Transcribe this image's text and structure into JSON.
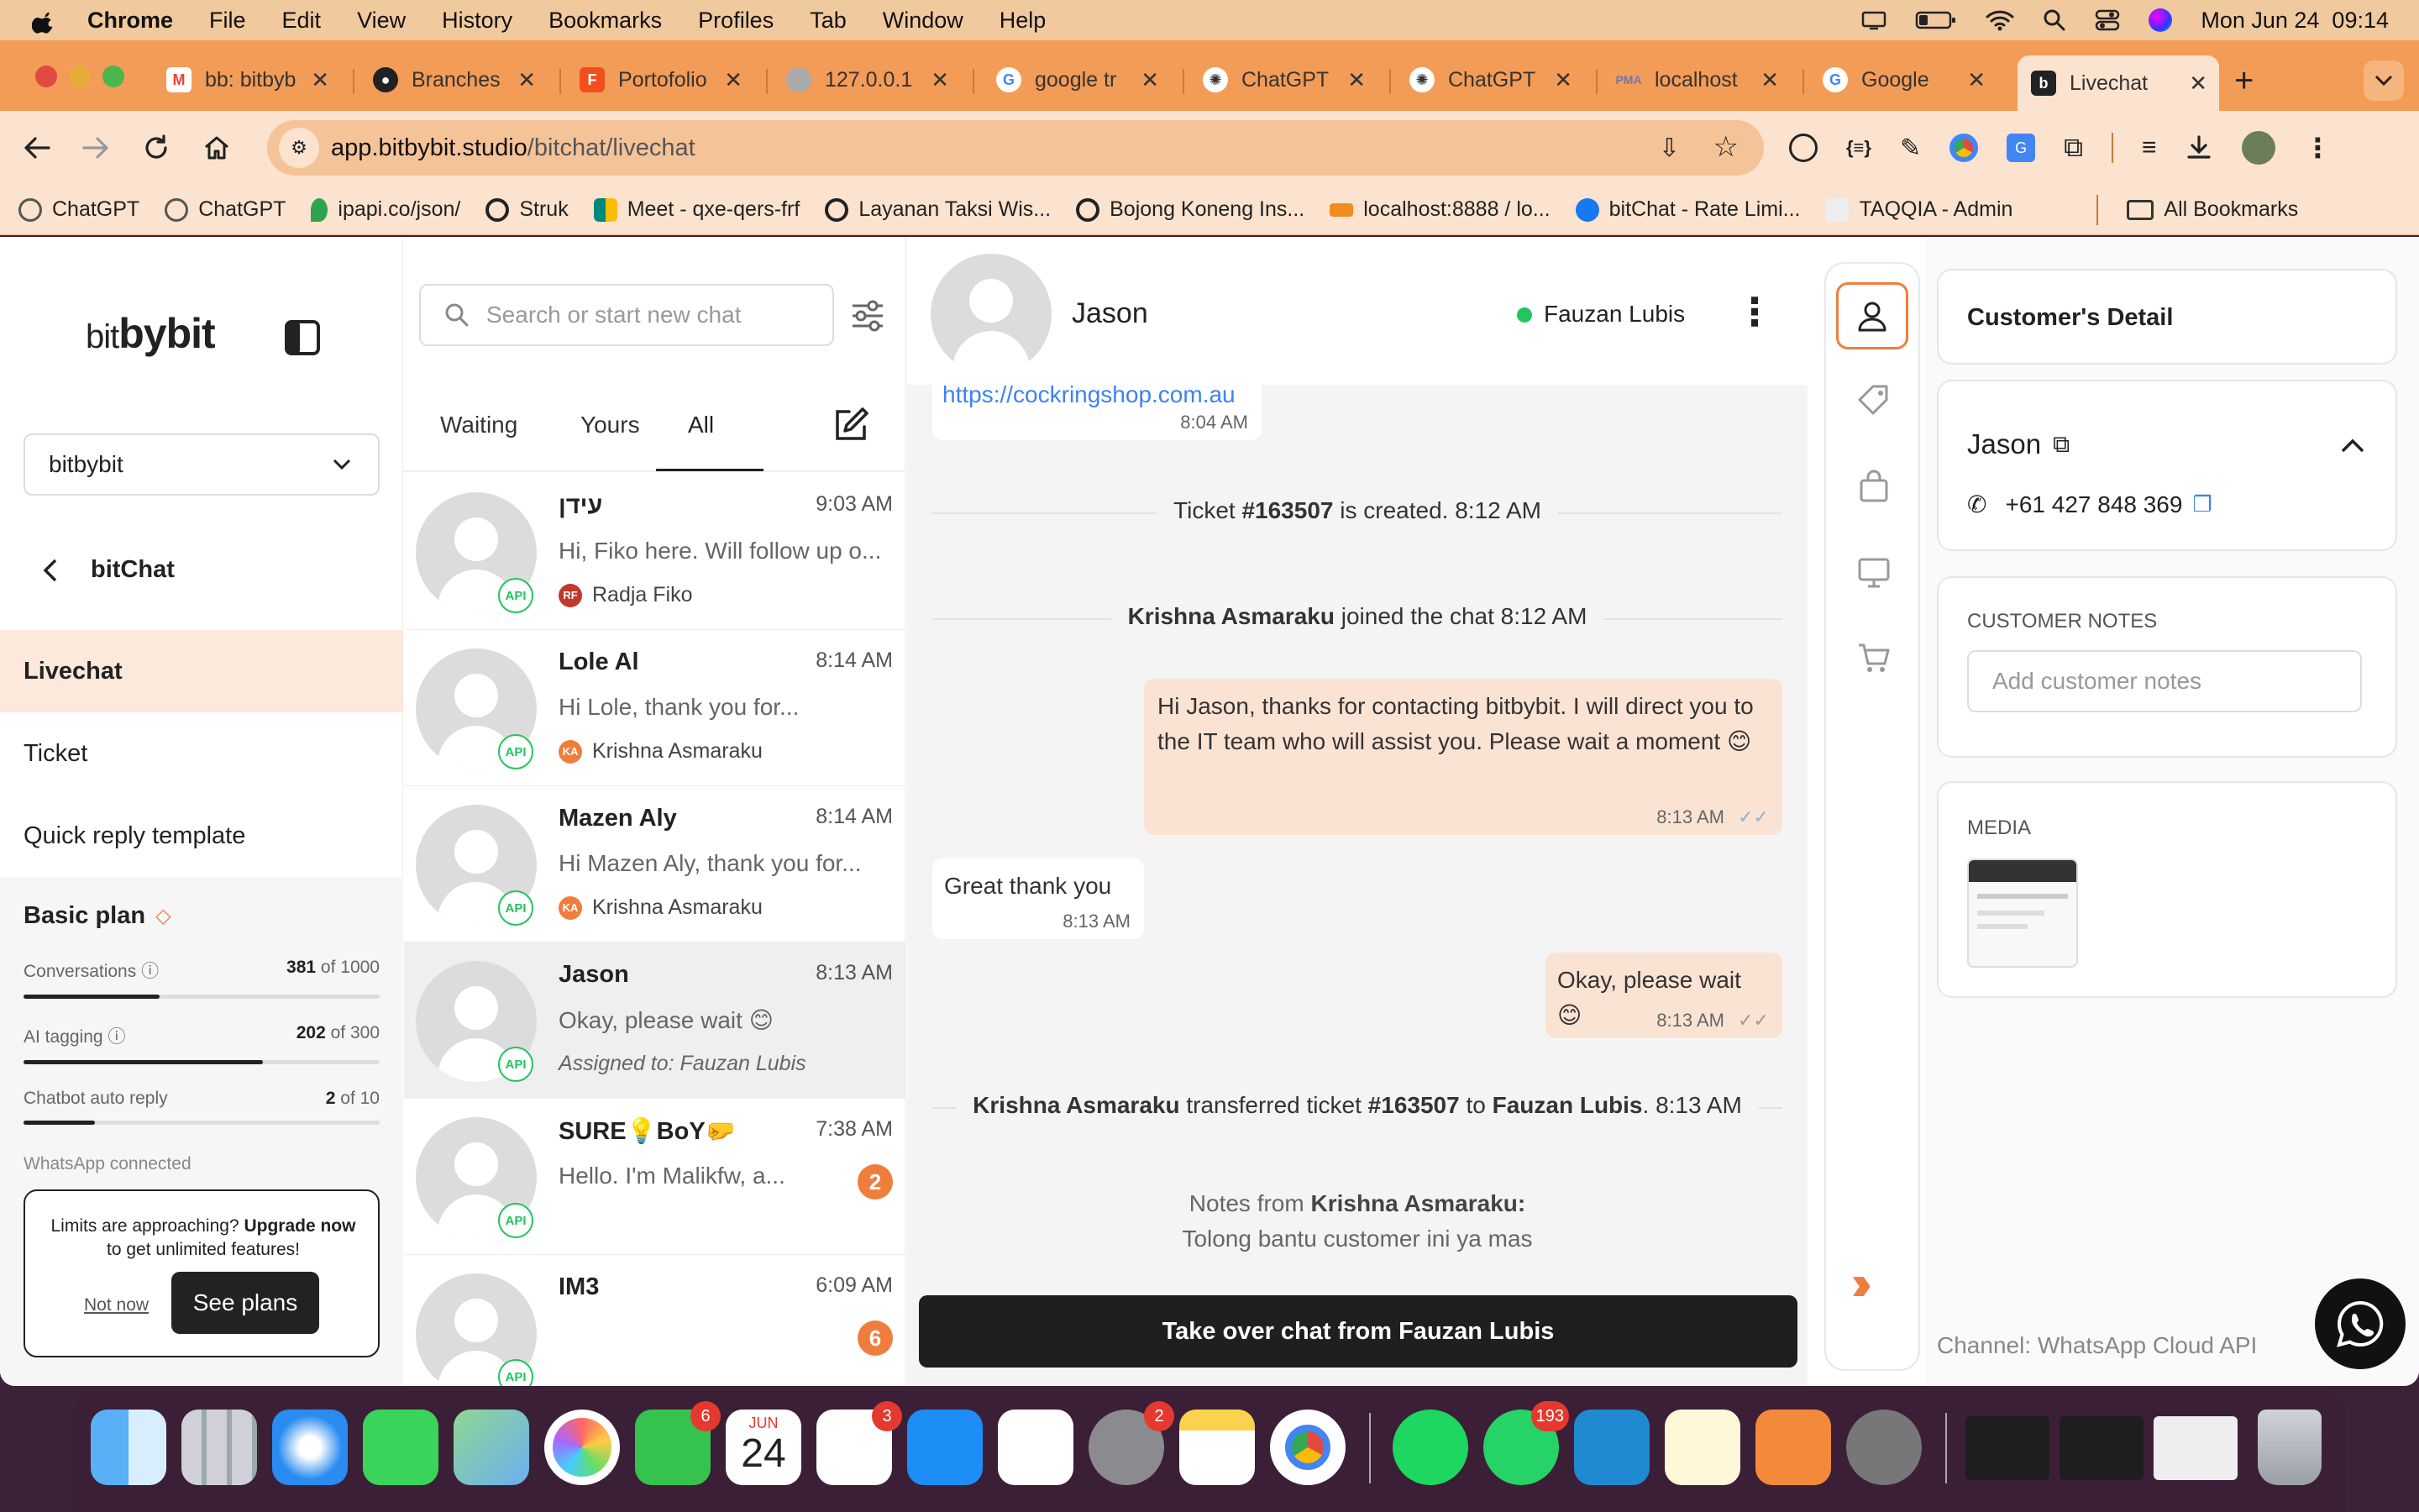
{
  "menubar": {
    "app_name": "Chrome",
    "items": [
      "File",
      "Edit",
      "View",
      "History",
      "Bookmarks",
      "Profiles",
      "Tab",
      "Window",
      "Help"
    ],
    "clock": "Mon Jun 24  09:14"
  },
  "tabs": [
    {
      "title": "bb: bitbyb",
      "icon": "gmail-icon",
      "color": "#ea4335"
    },
    {
      "title": "Branches",
      "icon": "github-icon",
      "color": "#222222"
    },
    {
      "title": "Portofolio",
      "icon": "figma-icon",
      "color": "#f24e1e"
    },
    {
      "title": "127.0.0.1",
      "icon": "globe-icon",
      "color": "#888888"
    },
    {
      "title": "google tr",
      "icon": "google-icon",
      "color": "#4285f4"
    },
    {
      "title": "ChatGPT",
      "icon": "chatgpt-icon",
      "color": "#333333"
    },
    {
      "title": "ChatGPT",
      "icon": "chatgpt-icon",
      "color": "#333333"
    },
    {
      "title": "localhost",
      "icon": "pma-icon",
      "color": "#6c78af"
    },
    {
      "title": "Google",
      "icon": "google-icon",
      "color": "#4285f4"
    },
    {
      "title": "Livechat",
      "icon": "bitbybit-icon",
      "color": "#222222",
      "active": true
    }
  ],
  "address": {
    "domain": "app.bitbybit.studio",
    "path": "/bitchat/livechat"
  },
  "bookmarks": [
    {
      "label": "ChatGPT",
      "color": "#555555"
    },
    {
      "label": "ChatGPT",
      "color": "#555555"
    },
    {
      "label": "ipapi.co/json/",
      "color": "#2ea44f"
    },
    {
      "label": "Struk",
      "color": "#222222"
    },
    {
      "label": "Meet - qxe-qers-frf",
      "color": "#00897b"
    },
    {
      "label": "Layanan Taksi Wis...",
      "color": "#222222"
    },
    {
      "label": "Bojong Koneng Ins...",
      "color": "#222222"
    },
    {
      "label": "localhost:8888 / lo...",
      "color": "#f28b20"
    },
    {
      "label": "bitChat - Rate Limi...",
      "color": "#1877f2"
    },
    {
      "label": "TAQQIA - Admin",
      "color": "#cccccc"
    }
  ],
  "bookmarks_all": "All Bookmarks",
  "sidebar": {
    "logo_light": "bit",
    "logo_bold": "bybit",
    "workspace": "bitbybit",
    "section": "bitChat",
    "menu": [
      {
        "label": "Livechat",
        "active": true
      },
      {
        "label": "Ticket",
        "active": false
      },
      {
        "label": "Quick reply template",
        "active": false
      }
    ],
    "plan": {
      "name": "Basic plan",
      "usage": [
        {
          "label": "Conversations",
          "used": "381",
          "total": "of 1000",
          "ratio": 0.381
        },
        {
          "label": "AI tagging",
          "used": "202",
          "total": "of 300",
          "ratio": 0.673
        },
        {
          "label": "Chatbot auto reply",
          "used": "2",
          "total": "of 10",
          "ratio": 0.2
        }
      ],
      "whatsapp": "WhatsApp connected"
    },
    "upgrade": {
      "text_pre": "Limits are approaching? ",
      "text_bold": "Upgrade now",
      "text_post": " to get unlimited features!",
      "not_now": "Not now",
      "see_plans": "See plans"
    }
  },
  "chatlist": {
    "search_placeholder": "Search or start new chat",
    "filters": [
      "Waiting",
      "Yours",
      "All"
    ],
    "active_filter": "All",
    "api_badge": "API",
    "chats": [
      {
        "name": "עידן",
        "time": "9:03 AM",
        "message": "Hi, Fiko here. Will follow up o...",
        "agent": "Radja Fiko",
        "agent_initials": "RF",
        "agent_color": "#c0392b"
      },
      {
        "name": "Lole Al",
        "time": "8:14 AM",
        "message": "Hi Lole, thank you for...",
        "agent": "Krishna Asmaraku",
        "agent_initials": "KA",
        "agent_color": "#ef7e3d"
      },
      {
        "name": "Mazen Aly",
        "time": "8:14 AM",
        "message": "Hi Mazen Aly, thank you for...",
        "agent": "Krishna Asmaraku",
        "agent_initials": "KA",
        "agent_color": "#ef7e3d"
      },
      {
        "name": "Jason",
        "time": "8:13 AM",
        "message": "Okay, please wait 😊",
        "assigned": "Assigned to: Fauzan Lubis",
        "selected": true
      },
      {
        "name": "SURE💡BoY🤛",
        "time": "7:38 AM",
        "message": "Hello. I'm Malikfw, a...",
        "unread": "2"
      },
      {
        "name": "IM3",
        "time": "6:09 AM",
        "message": "",
        "unread": "6"
      }
    ]
  },
  "conversation": {
    "contact_name": "Jason",
    "assignee": "Fauzan Lubis",
    "link": "https://cockringshop.com.au",
    "link_time": "8:04 AM",
    "ticket_created": {
      "pre": "Ticket ",
      "bold": "#163507",
      "post": " is created. 8:12 AM"
    },
    "joined": {
      "bold": "Krishna Asmaraku",
      "post": " joined the chat 8:12 AM"
    },
    "messages": [
      {
        "dir": "out",
        "text": "Hi Jason, thanks for contacting bitbybit. I will direct you to the IT team who will assist you. Please wait a moment 😊",
        "time": "8:13 AM"
      },
      {
        "dir": "in",
        "text": "Great thank you",
        "time": "8:13 AM"
      },
      {
        "dir": "out",
        "text": "Okay, please wait 😊",
        "time": "8:13 AM"
      }
    ],
    "transfer": {
      "who": "Krishna Asmaraku",
      "mid": " transferred ticket ",
      "ticket": "#163507",
      "to": " to ",
      "target": "Fauzan Lubis",
      "post": ". 8:13 AM"
    },
    "notes_label_pre": "Notes from ",
    "notes_label_bold": "Krishna Asmaraku:",
    "notes_text": "Tolong bantu customer ini ya mas",
    "takeover_button": "Take over chat from Fauzan Lubis"
  },
  "rightpanel": {
    "title": "Customer's Detail",
    "customer_name": "Jason",
    "phone": "+61 427 848 369",
    "notes_label": "CUSTOMER NOTES",
    "notes_placeholder": "Add customer notes",
    "media_label": "MEDIA",
    "channel": "Channel: WhatsApp Cloud API"
  },
  "dock": {
    "badges": {
      "facetime": "6",
      "calendar_month": "JUN",
      "calendar_day": "24",
      "reminders": "3",
      "settings": "2",
      "whatsapp": "193"
    }
  },
  "colors": {
    "accent": "#ef7e3d",
    "active_bg": "#fde8dc",
    "online": "#22c55e",
    "outgoing_bubble": "#fbe3d3"
  }
}
